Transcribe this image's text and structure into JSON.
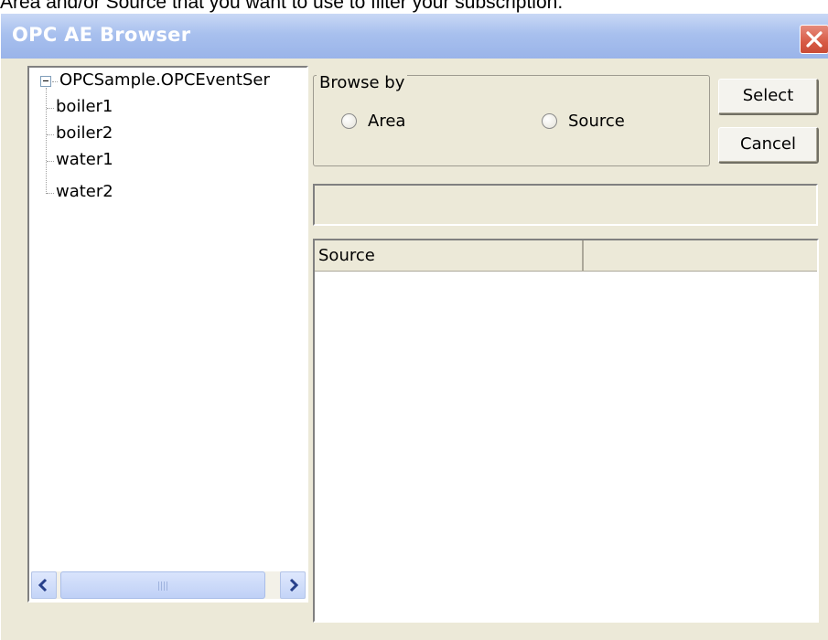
{
  "caption": "Area and/or Source that you want to use to filter your subscription.",
  "window": {
    "title": "OPC AE Browser"
  },
  "tree": {
    "root": "OPCSample.OPCEventSer",
    "children": [
      "boiler1",
      "boiler2",
      "water1",
      "water2"
    ]
  },
  "browse": {
    "group_label": "Browse by",
    "options": [
      "Area",
      "Source"
    ]
  },
  "buttons": {
    "select": "Select",
    "cancel": "Cancel"
  },
  "path_value": "",
  "list": {
    "columns": [
      "Source",
      ""
    ]
  },
  "scrollbar": {
    "left_arrow": "<",
    "right_arrow": ">"
  }
}
